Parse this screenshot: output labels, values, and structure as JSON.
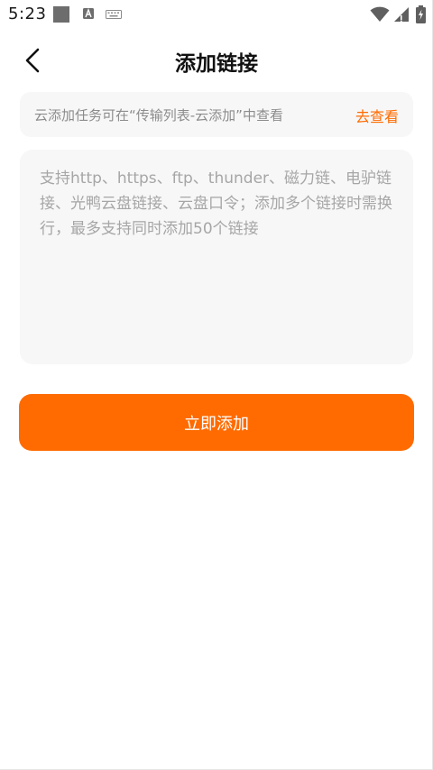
{
  "status_bar": {
    "time": "5:23",
    "icons": [
      "notification-square-icon",
      "a-letter-icon",
      "keyboard-icon",
      "wifi-icon",
      "cell-signal-icon",
      "battery-charging-icon"
    ]
  },
  "header": {
    "title": "添加链接",
    "back_icon": "chevron-left-icon"
  },
  "notice": {
    "text": "云添加任务可在“传输列表-云添加”中查看",
    "link_label": "去查看",
    "link_color": "#ff6b00"
  },
  "link_input": {
    "value": "",
    "placeholder": "支持http、https、ftp、thunder、磁力链、电驴链接、光鸭云盘链接、云盘口令；添加多个链接时需换行，最多支持同时添加50个链接"
  },
  "submit": {
    "label": "立即添加",
    "color": "#ff6b00"
  }
}
